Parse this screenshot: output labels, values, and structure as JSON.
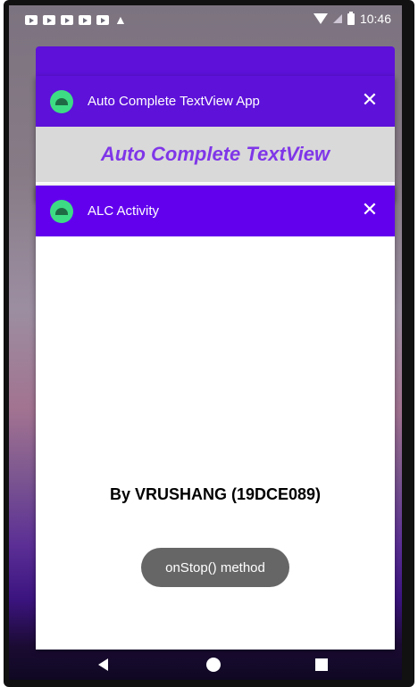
{
  "status_bar": {
    "time": "10:46",
    "left_icons": [
      "play-notification-icon",
      "play-notification-icon",
      "play-notification-icon",
      "play-notification-icon",
      "play-notification-icon",
      "warning-icon"
    ],
    "right_icons": [
      "wifi-icon",
      "signal-icon",
      "battery-icon"
    ]
  },
  "recents": {
    "card_back": {
      "color": "#5d11d9"
    },
    "card1": {
      "title": "Auto Complete TextView App",
      "close_icon": "✕",
      "preview_text": "Auto Complete TextView",
      "bar_color": "#5d11d9"
    },
    "card2": {
      "title": "ALC Activity",
      "close_icon": "✕",
      "body_text": "By VRUSHANG (19DCE089)",
      "bar_color": "#6200ee"
    }
  },
  "toast": {
    "text": "onStop() method"
  },
  "nav_bar": {
    "icons": [
      "back-icon",
      "home-icon",
      "recents-icon"
    ]
  }
}
